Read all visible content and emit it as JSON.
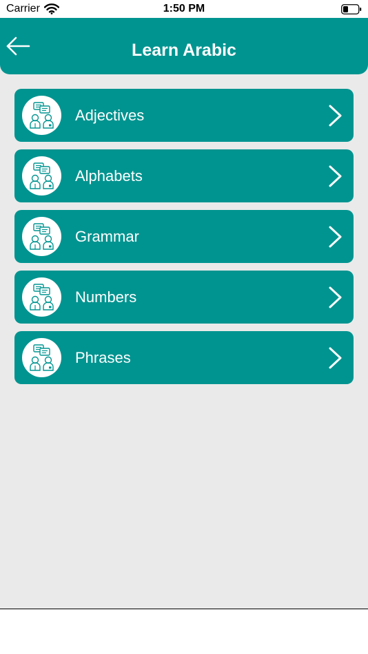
{
  "status_bar": {
    "carrier": "Carrier",
    "time": "1:50 PM",
    "wifi_icon": "wifi-icon",
    "battery_icon": "battery-icon"
  },
  "header": {
    "title": "Learn Arabic",
    "back_icon": "arrow-left-icon",
    "background_color": "#009490"
  },
  "topics": [
    {
      "label": "Adjectives",
      "icon": "conversation-icon"
    },
    {
      "label": "Alphabets",
      "icon": "conversation-icon"
    },
    {
      "label": "Grammar",
      "icon": "conversation-icon"
    },
    {
      "label": "Numbers",
      "icon": "conversation-icon"
    },
    {
      "label": "Phrases",
      "icon": "conversation-icon"
    }
  ],
  "colors": {
    "accent": "#009490",
    "content_background": "#eaeaea"
  }
}
